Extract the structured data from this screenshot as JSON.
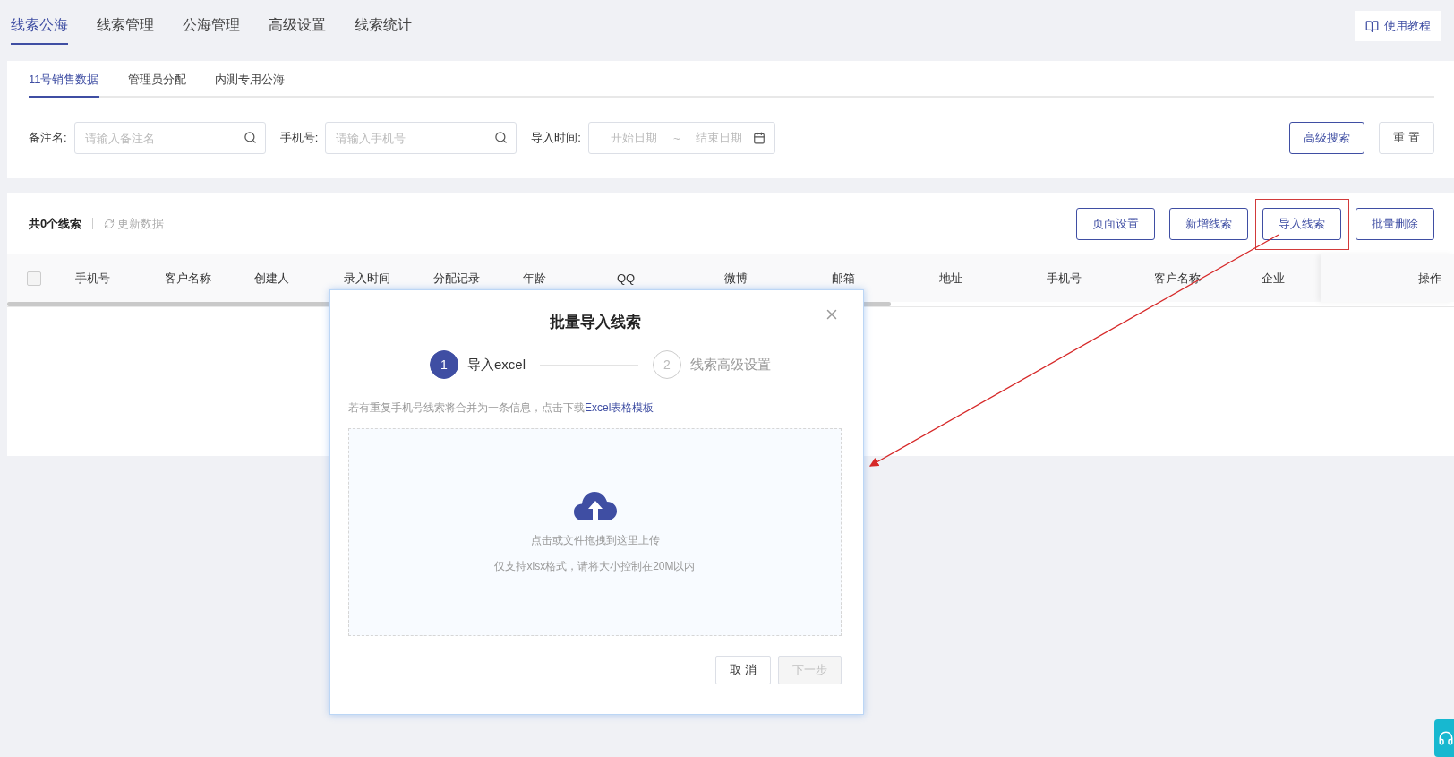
{
  "top_tabs": [
    {
      "label": "线索公海",
      "selected": true
    },
    {
      "label": "线索管理",
      "selected": false
    },
    {
      "label": "公海管理",
      "selected": false
    },
    {
      "label": "高级设置",
      "selected": false
    },
    {
      "label": "线索统计",
      "selected": false
    }
  ],
  "help_button": {
    "label": "使用教程"
  },
  "sub_tabs": [
    {
      "label": "11号销售数据",
      "selected": true
    },
    {
      "label": "管理员分配",
      "selected": false
    },
    {
      "label": "内测专用公海",
      "selected": false
    }
  ],
  "filters": [
    {
      "kind": "text",
      "label": "备注名:",
      "placeholder": "请输入备注名"
    },
    {
      "kind": "text",
      "label": "手机号:",
      "placeholder": "请输入手机号"
    },
    {
      "kind": "date_range",
      "label": "导入时间:",
      "start_placeholder": "开始日期",
      "separator": "~",
      "end_placeholder": "结束日期"
    }
  ],
  "filter_buttons": [
    {
      "label": "高级搜索",
      "kind": "primary"
    },
    {
      "label": "重 置",
      "kind": "default"
    }
  ],
  "list_toolbar": {
    "count": "共0个线索",
    "refresh": "更新数据"
  },
  "actions": [
    {
      "label": "页面设置",
      "annotated": false
    },
    {
      "label": "新增线索",
      "annotated": false
    },
    {
      "label": "导入线索",
      "annotated": true
    },
    {
      "label": "批量删除",
      "annotated": false
    }
  ],
  "table": {
    "select_all_checked": false,
    "columns": [
      "手机号",
      "客户名称",
      "创建人",
      "录入时间",
      "分配记录",
      "年龄",
      "QQ",
      "微博",
      "邮箱",
      "地址",
      "手机号",
      "客户名称",
      "企业"
    ],
    "action_column": "操作"
  },
  "dialog": {
    "title": "批量导入线索",
    "steps": [
      {
        "number": "1",
        "label": "导入excel",
        "selected": true
      },
      {
        "number": "2",
        "label": "线索高级设置",
        "selected": false
      }
    ],
    "hint": "若有重复手机号线索将合并为一条信息，点击下载",
    "template_link": "Excel表格模板",
    "upload_text": "点击或文件拖拽到这里上传",
    "upload_note": "仅支持xlsx格式，请将大小控制在20M以内",
    "buttons": [
      {
        "label": "取 消",
        "disabled": false
      },
      {
        "label": "下一步",
        "disabled": true
      }
    ]
  }
}
